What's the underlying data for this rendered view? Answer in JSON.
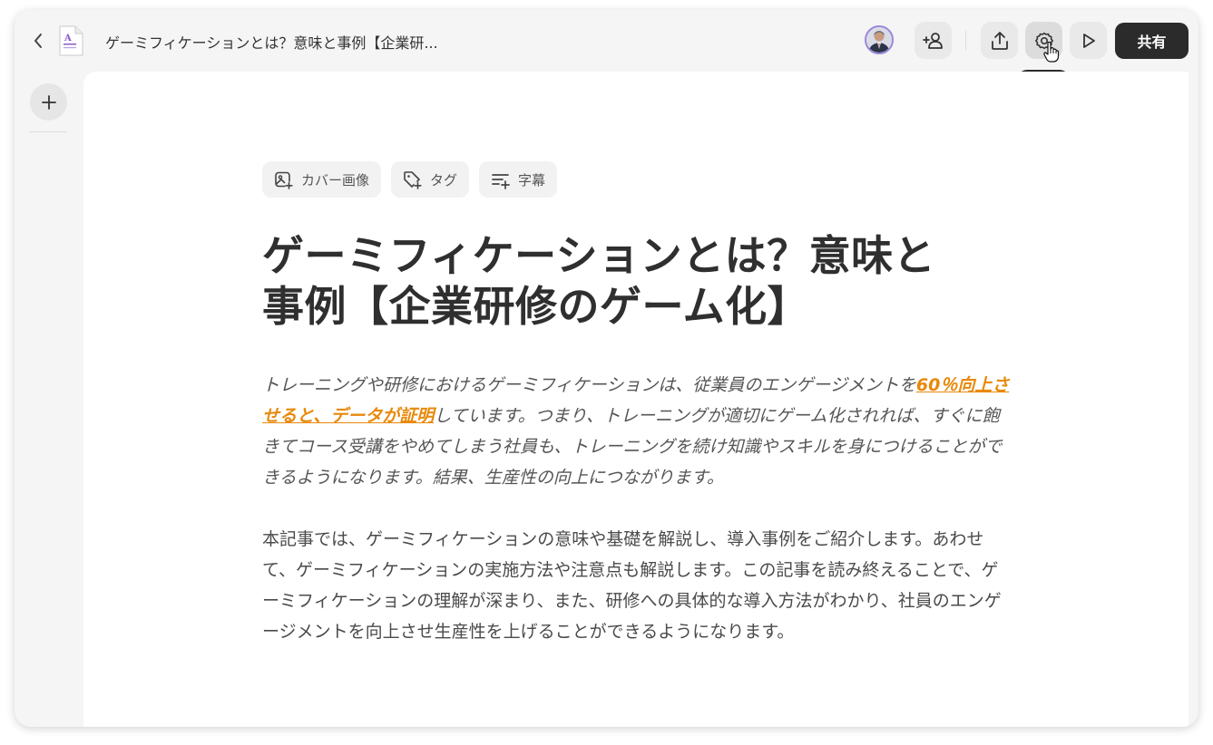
{
  "header": {
    "doc_title": "ゲーミフィケーションとは？意味と事例【企業研...",
    "share_label": "共有",
    "tooltip": "設定"
  },
  "chips": [
    {
      "label": "カバー画像",
      "icon": "image-add-icon"
    },
    {
      "label": "タグ",
      "icon": "tag-add-icon"
    },
    {
      "label": "字幕",
      "icon": "subtitle-add-icon"
    }
  ],
  "article": {
    "title_line1": "ゲーミフィケーションとは？意味と",
    "title_line2": "事例【企業研修のゲーム化】",
    "p1_before": "トレーニングや研修におけるゲーミフィケーションは、従業員のエンゲージメントを",
    "p1_link": "60％向上させると、データが証明",
    "p1_after": "しています。つまり、トレーニングが適切にゲーム化されれば、すぐに飽きてコース受講をやめてしまう社員も、トレーニングを続け知識やスキルを身につけることができるようになります。結果、生産性の向上につながります。",
    "p2": "本記事では、ゲーミフィケーションの意味や基礎を解説し、導入事例をご紹介します。あわせて、ゲーミフィケーションの実施方法や注意点も解説します。この記事を読み終えることで、ゲーミフィケーションの理解が深まり、また、研修への具体的な導入方法がわかり、社員のエンゲージメントを向上させ生産性を上げることができるようになります。"
  },
  "colors": {
    "accent": "#e8890b",
    "dark_button": "#2b2b2b",
    "avatar_ring": "#9b87d9"
  }
}
